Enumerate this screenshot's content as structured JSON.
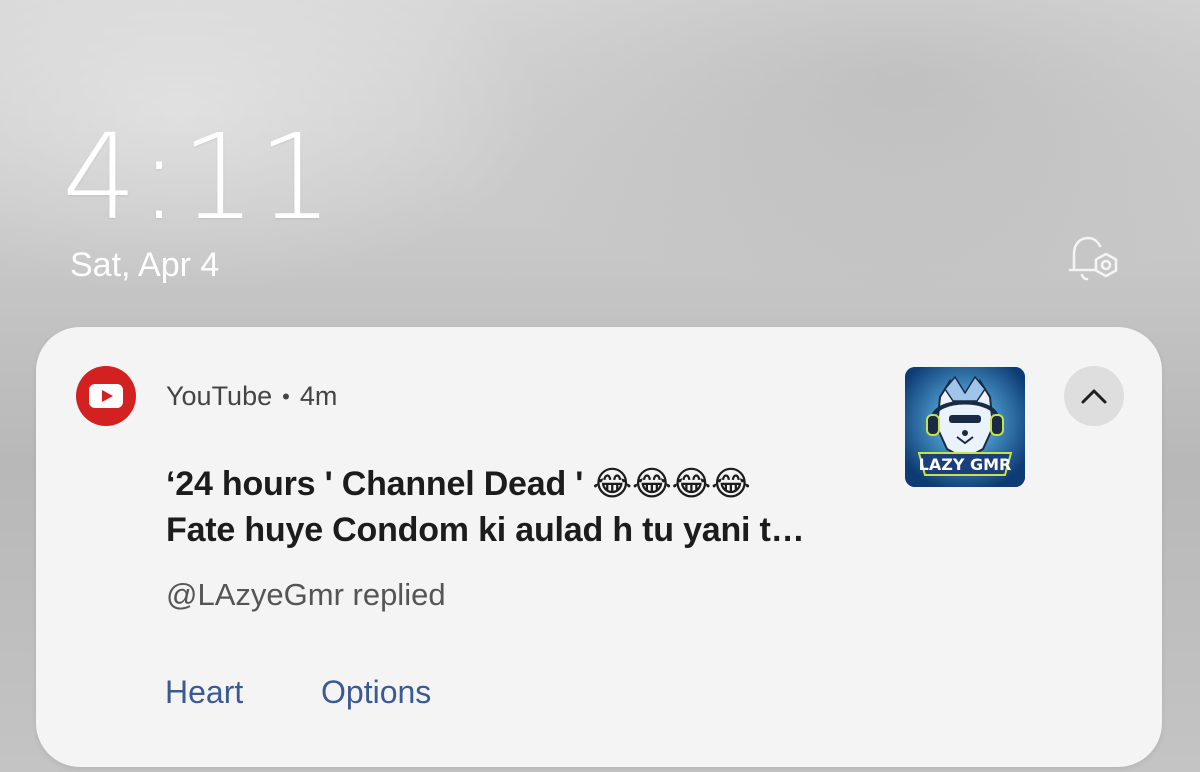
{
  "lockscreen": {
    "time": "4:11",
    "date": "Sat, Apr 4"
  },
  "notification": {
    "app_name": "YouTube",
    "separator": "•",
    "time_ago": "4m",
    "title_line1": "‘24 hours ' Channel Dead ' 😂😂😂😂",
    "title_line2": "Fate huye Condom ki aulad h tu yani t…",
    "subtext": "@LAzyeGmr replied",
    "thumbnail_text": "LAZY GMR",
    "actions": {
      "heart": "Heart",
      "options": "Options"
    },
    "icons": {
      "app": "youtube-icon",
      "collapse": "chevron-up-icon",
      "bell": "bell-settings-icon"
    },
    "colors": {
      "youtube_red": "#d32020",
      "action_blue": "#3b5a94"
    }
  }
}
